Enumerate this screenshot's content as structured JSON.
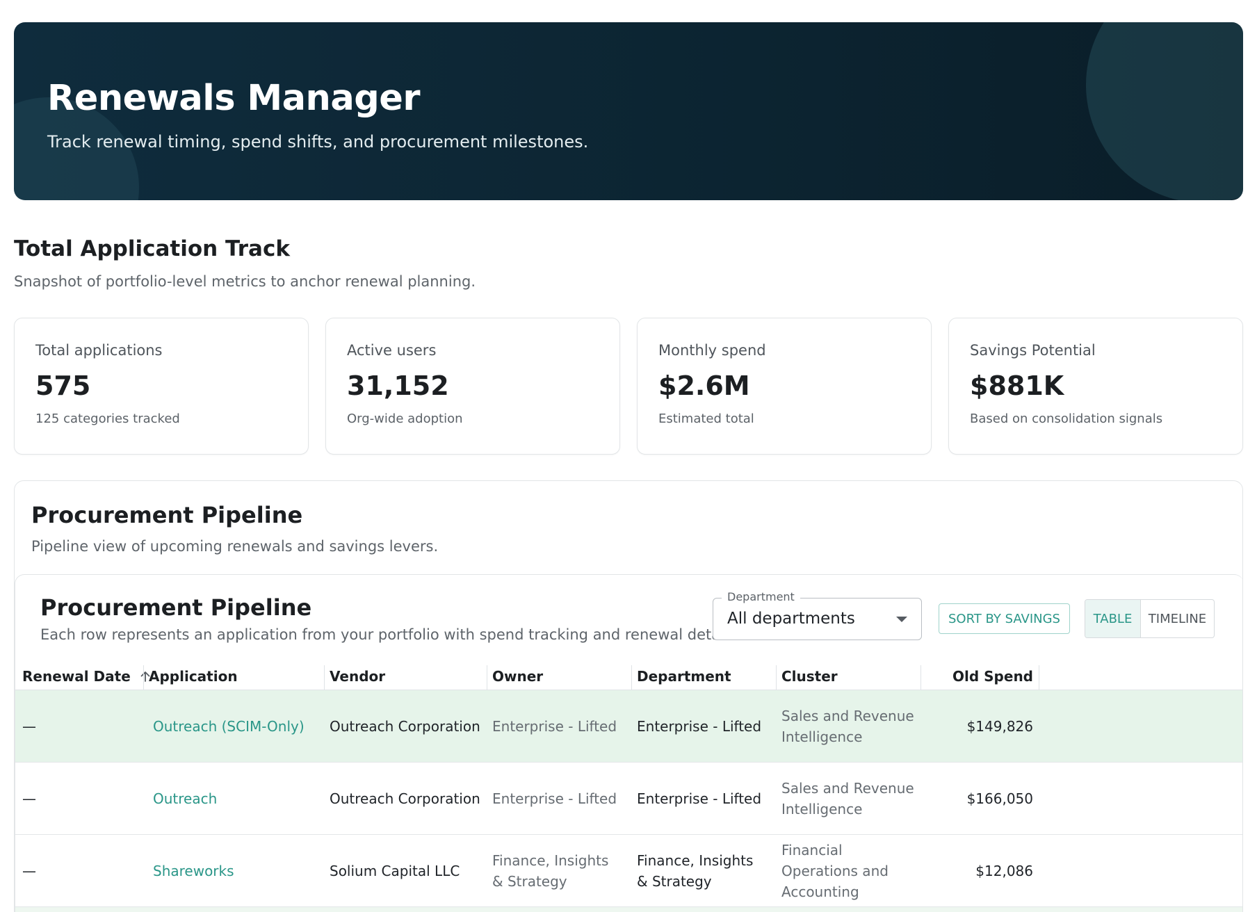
{
  "header": {
    "title": "Renewals Manager",
    "subtitle": "Track renewal timing, spend shifts, and procurement milestones."
  },
  "summary": {
    "title": "Total Application Track",
    "subtitle": "Snapshot of portfolio-level metrics to anchor renewal planning.",
    "cards": [
      {
        "label": "Total applications",
        "value": "575",
        "note": "125 categories tracked"
      },
      {
        "label": "Active users",
        "value": "31,152",
        "note": "Org-wide adoption"
      },
      {
        "label": "Monthly spend",
        "value": "$2.6M",
        "note": "Estimated total"
      },
      {
        "label": "Savings Potential",
        "value": "$881K",
        "note": "Based on consolidation signals"
      }
    ]
  },
  "pipeline": {
    "title": "Procurement Pipeline",
    "subtitle": "Pipeline view of upcoming renewals and savings levers.",
    "panel": {
      "title": "Procurement Pipeline",
      "subtitle": "Each row represents an application from your portfolio with spend tracking and renewal details.",
      "department_filter": {
        "label": "Department",
        "value": "All departments"
      },
      "sort_button": "SORT BY SAVINGS",
      "view_toggle": {
        "active": "TABLE",
        "other": "TIMELINE"
      }
    },
    "table": {
      "columns": [
        "Renewal Date",
        "Application",
        "Vendor",
        "Owner",
        "Department",
        "Cluster",
        "Old Spend"
      ],
      "sorted_column": "Renewal Date",
      "sort_direction": "ascending",
      "rows": [
        {
          "renewal_date": "—",
          "application": "Outreach (SCIM-Only)",
          "vendor": "Outreach Corporation",
          "owner": "Enterprise - Lifted",
          "department": "Enterprise - Lifted",
          "cluster": "Sales and Revenue Intelligence",
          "old_spend": "$149,826",
          "highlighted": true
        },
        {
          "renewal_date": "—",
          "application": "Outreach",
          "vendor": "Outreach Corporation",
          "owner": "Enterprise - Lifted",
          "department": "Enterprise - Lifted",
          "cluster": "Sales and Revenue Intelligence",
          "old_spend": "$166,050",
          "highlighted": false
        },
        {
          "renewal_date": "—",
          "application": "Shareworks",
          "vendor": "Solium Capital LLC",
          "owner": "Finance, Insights & Strategy",
          "department": "Finance, Insights & Strategy",
          "cluster": "Financial Operations and Accounting",
          "old_spend": "$12,086",
          "highlighted": false
        }
      ]
    }
  },
  "colors": {
    "hero_bg": "#0c2431",
    "accent": "#2a9688",
    "row_highlight": "#e6f4ea"
  },
  "icons": {
    "sort": "arrow-up-icon",
    "dropdown": "caret-down-icon"
  }
}
